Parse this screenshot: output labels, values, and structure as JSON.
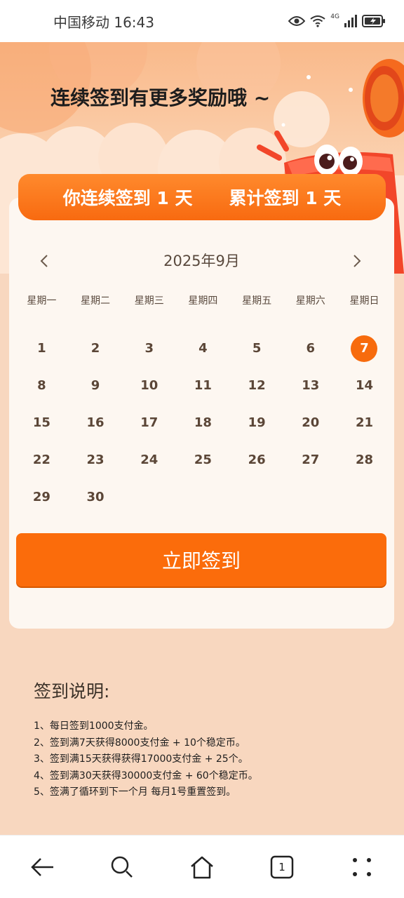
{
  "status_bar": {
    "carrier_time": "中国移动 16:43",
    "network": "4G"
  },
  "banner": {
    "title": "连续签到有更多奖励哦 ~"
  },
  "streak": {
    "consecutive": "你连续签到 1 天",
    "total": "累计签到 1 天"
  },
  "calendar": {
    "month_label": "2025年9月",
    "weekdays": [
      "星期一",
      "星期二",
      "星期三",
      "星期四",
      "星期五",
      "星期六",
      "星期日"
    ],
    "days": [
      "1",
      "2",
      "3",
      "4",
      "5",
      "6",
      "7",
      "8",
      "9",
      "10",
      "11",
      "12",
      "13",
      "14",
      "15",
      "16",
      "17",
      "18",
      "19",
      "20",
      "21",
      "22",
      "23",
      "24",
      "25",
      "26",
      "27",
      "28",
      "29",
      "30"
    ],
    "today": "7"
  },
  "checkin_button": {
    "label": "立即签到"
  },
  "rules": {
    "title": "签到说明:",
    "items": [
      "1、每日签到1000支付金。",
      "2、签到满7天获得8000支付金 + 10个稳定币。",
      "3、签到满15天获得获得17000支付金 + 25个。",
      "4、签到满30天获得30000支付金 + 60个稳定币。",
      "5、签满了循环到下一个月 每月1号重置签到。"
    ]
  },
  "bottom_nav": {
    "tab_count": "1"
  },
  "colors": {
    "accent": "#fb6c0b",
    "background": "#f8d7bf",
    "card": "#fdf7f1",
    "day_text": "#5b4637"
  }
}
